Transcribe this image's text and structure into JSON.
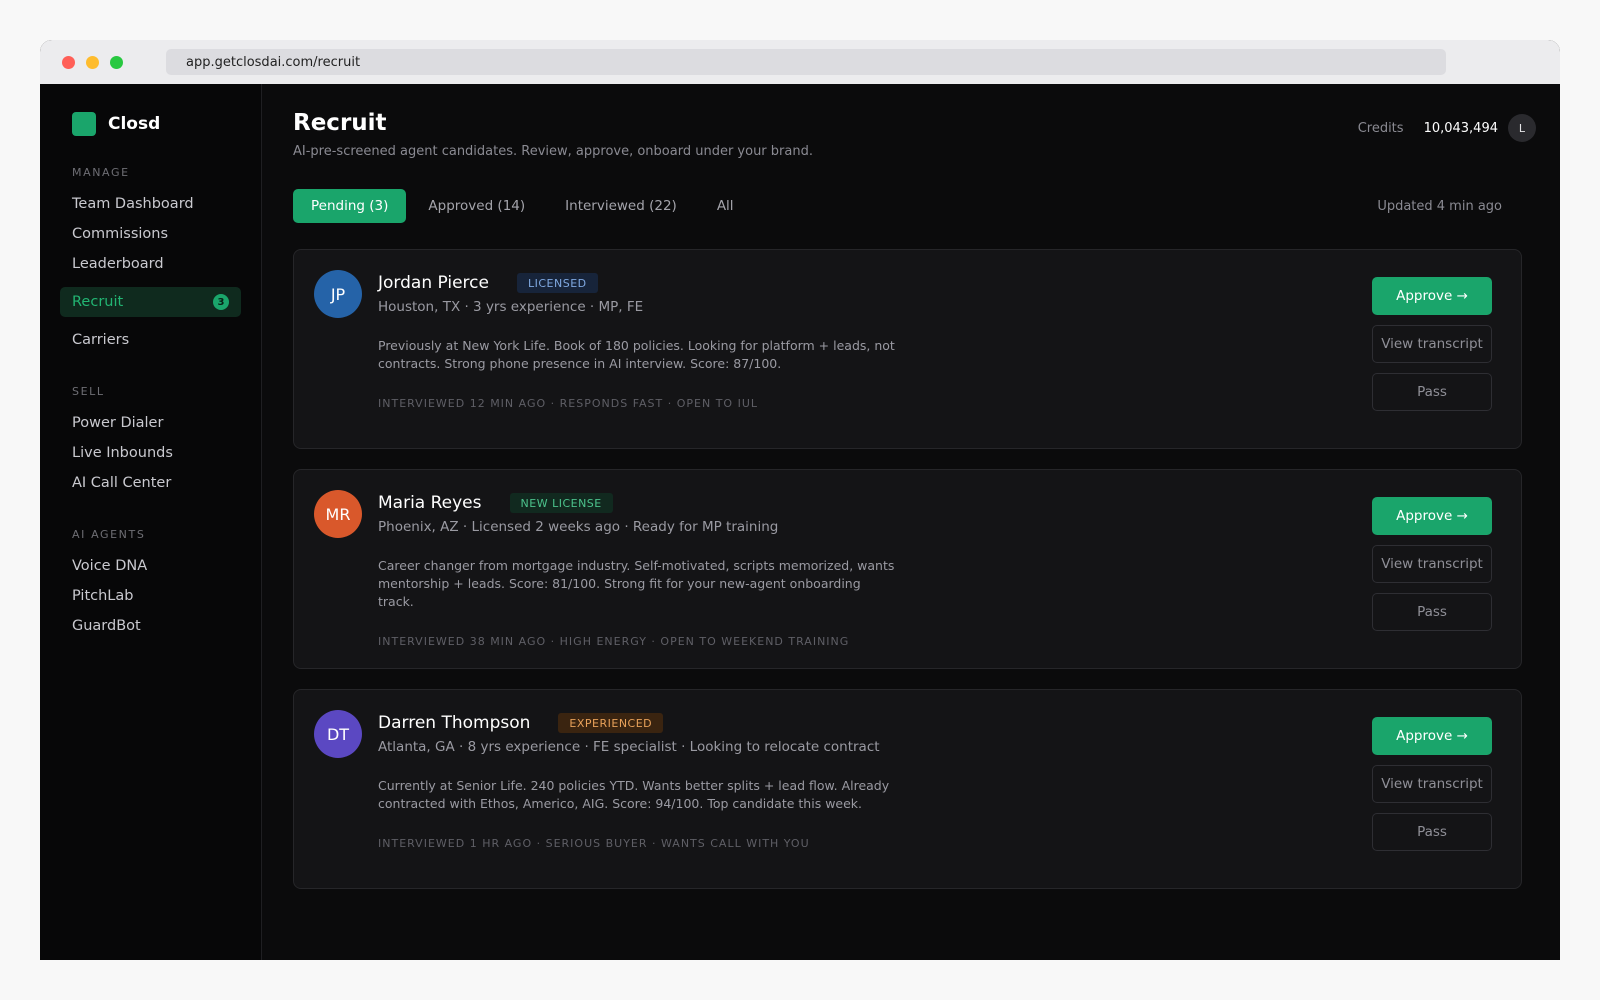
{
  "browser": {
    "url": "app.getclosdai.com/recruit"
  },
  "brand": {
    "name": "Closd",
    "color": "#1aa56b"
  },
  "sidebar": {
    "sections": [
      {
        "label": "MANAGE",
        "items": [
          {
            "label": "Team Dashboard"
          },
          {
            "label": "Commissions"
          },
          {
            "label": "Leaderboard"
          },
          {
            "label": "Recruit",
            "active": true,
            "badge": "3"
          },
          {
            "label": "Carriers"
          }
        ]
      },
      {
        "label": "SELL",
        "items": [
          {
            "label": "Power Dialer"
          },
          {
            "label": "Live Inbounds"
          },
          {
            "label": "AI Call Center"
          }
        ]
      },
      {
        "label": "AI AGENTS",
        "items": [
          {
            "label": "Voice DNA"
          },
          {
            "label": "PitchLab"
          },
          {
            "label": "GuardBot"
          }
        ]
      }
    ]
  },
  "header": {
    "title": "Recruit",
    "subtitle": "AI-pre-screened agent candidates. Review, approve, onboard under your brand.",
    "credits_label": "Credits",
    "credits_value": "10,043,494",
    "user_initial": "L"
  },
  "tabs": [
    {
      "label": "Pending (3)",
      "active": true
    },
    {
      "label": "Approved (14)"
    },
    {
      "label": "Interviewed (22)"
    },
    {
      "label": "All"
    }
  ],
  "updated": "Updated 4 min ago",
  "candidates": [
    {
      "initials": "JP",
      "avatar_color": "#2563a8",
      "name": "Jordan Pierce",
      "tag": "LICENSED",
      "tag_bg": "#17243a",
      "tag_color": "#7fa8e0",
      "meta": "Houston, TX · 3 yrs experience · MP, FE",
      "desc": "Previously at New York Life. Book of 180 policies. Looking for platform + leads, not contracts. Strong phone presence in AI interview. Score: 87/100.",
      "foot": "INTERVIEWED 12 MIN AGO · RESPONDS FAST · OPEN TO IUL"
    },
    {
      "initials": "MR",
      "avatar_color": "#d9582b",
      "name": "Maria Reyes",
      "tag": "NEW LICENSE",
      "tag_bg": "#11291f",
      "tag_color": "#4cc28c",
      "meta": "Phoenix, AZ · Licensed 2 weeks ago · Ready for MP training",
      "desc": "Career changer from mortgage industry. Self-motivated, scripts memorized, wants mentorship + leads. Score: 81/100. Strong fit for your new-agent onboarding track.",
      "foot": "INTERVIEWED 38 MIN AGO · HIGH ENERGY · OPEN TO WEEKEND TRAINING"
    },
    {
      "initials": "DT",
      "avatar_color": "#5b48c2",
      "name": "Darren Thompson",
      "tag": "EXPERIENCED",
      "tag_bg": "#3a2410",
      "tag_color": "#e8a15a",
      "meta": "Atlanta, GA · 8 yrs experience · FE specialist · Looking to relocate contract",
      "desc": "Currently at Senior Life. 240 policies YTD. Wants better splits + lead flow. Already contracted with Ethos, Americo, AIG. Score: 94/100. Top candidate this week.",
      "foot": "INTERVIEWED 1 HR AGO · SERIOUS BUYER · WANTS CALL WITH YOU"
    }
  ],
  "actions": {
    "approve": "Approve →",
    "transcript": "View transcript",
    "pass": "Pass"
  }
}
